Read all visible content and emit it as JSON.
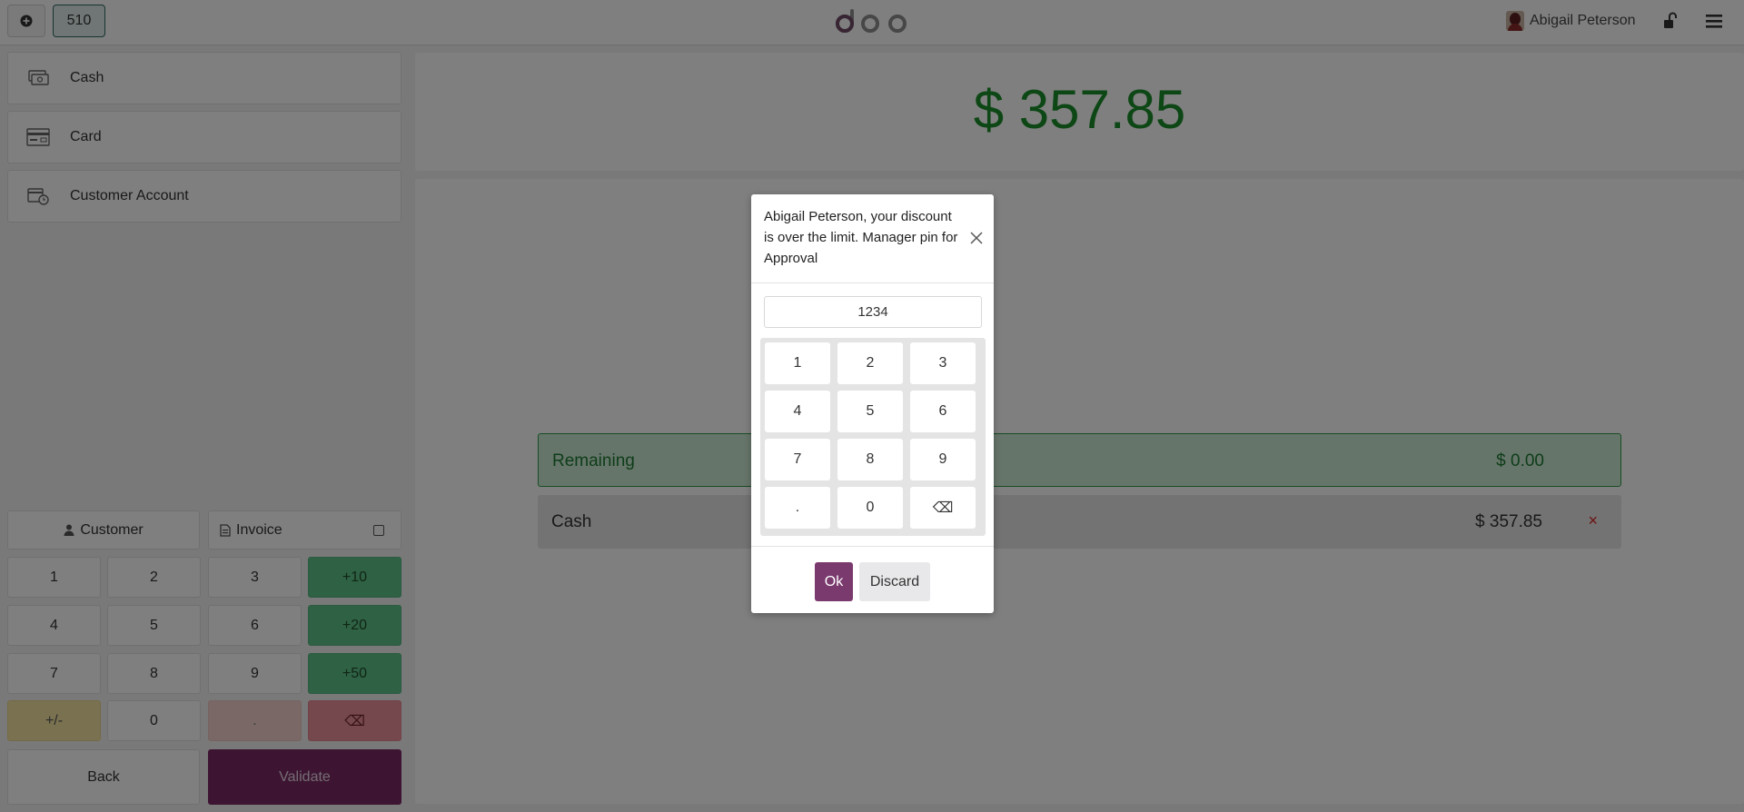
{
  "topbar": {
    "order_number": "510",
    "user_name": "Abigail Peterson"
  },
  "payment_methods": [
    {
      "label": "Cash",
      "icon": "cash-icon"
    },
    {
      "label": "Card",
      "icon": "card-icon"
    },
    {
      "label": "Customer Account",
      "icon": "customer-account-icon"
    }
  ],
  "controls": {
    "customer_label": "Customer",
    "invoice_label": "Invoice"
  },
  "numpad": {
    "keys": [
      "1",
      "2",
      "3",
      "+10",
      "4",
      "5",
      "6",
      "+20",
      "7",
      "8",
      "9",
      "+50",
      "+/-",
      "0",
      ".",
      "⌫"
    ]
  },
  "actions": {
    "back_label": "Back",
    "validate_label": "Validate"
  },
  "summary": {
    "total": "$ 357.85",
    "remaining_label": "Remaining",
    "remaining_value": "$ 0.00",
    "payment_line_label": "Cash",
    "payment_line_value": "$ 357.85",
    "payment_line_delete": "×"
  },
  "dialog": {
    "title": "Abigail Peterson, your discount is over the limit. Manager pin for Approval",
    "pin_value": "1234",
    "keys": [
      "1",
      "2",
      "3",
      "4",
      "5",
      "6",
      "7",
      "8",
      "9",
      ".",
      "0",
      "⌫"
    ],
    "ok_label": "Ok",
    "discard_label": "Discard"
  },
  "colors": {
    "brand": "#714B67",
    "validate": "#7a2a65",
    "success": "#1a8e2b"
  }
}
